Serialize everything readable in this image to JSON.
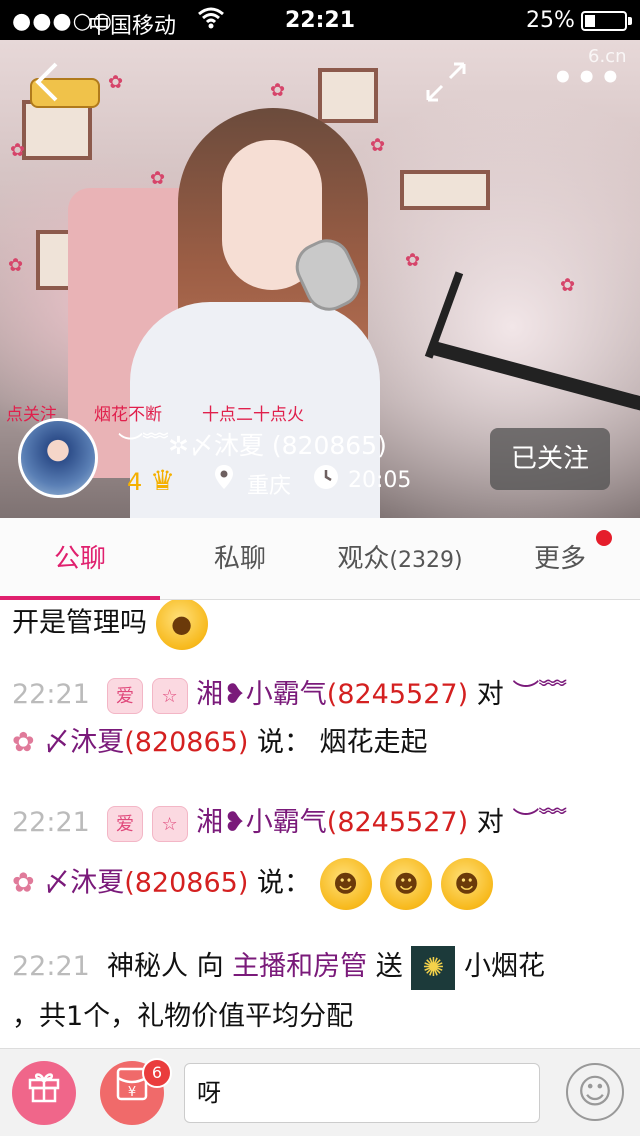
{
  "status_bar": {
    "signal": "●●●○○",
    "carrier": "中国移动",
    "wifi": "wifi",
    "time": "22:21",
    "battery": "25%"
  },
  "video": {
    "logo": "",
    "watermark": "6.cn",
    "tags": [
      "点关注",
      "烟花不断",
      "十点二十点火"
    ],
    "anchor_name": "︶﹌✲〆沐夏 (820865)",
    "level": "4",
    "location": "重庆",
    "duration": "20:05",
    "follow_label": "已关注"
  },
  "tabs": [
    {
      "label": "公聊",
      "count": "",
      "active": true
    },
    {
      "label": "私聊",
      "count": ""
    },
    {
      "label": "观众",
      "count": "(2329)"
    },
    {
      "label": "更多",
      "count": ""
    }
  ],
  "chat": {
    "msg0": {
      "text": "开是管理吗"
    },
    "msg1": {
      "time": "22:21",
      "badge1": "爱",
      "badge2": "☆",
      "sender": "湘❥小霸气",
      "sender_id": "(8245527)",
      "to": "对",
      "tail": "︶﹌",
      "target": "〆沐夏",
      "target_id": "(820865)",
      "said": "说：",
      "text": "烟花走起"
    },
    "msg2": {
      "time": "22:21",
      "badge1": "爱",
      "badge2": "☆",
      "sender": "湘❥小霸气",
      "sender_id": "(8245527)",
      "to": "对",
      "tail": "︶﹌",
      "target": "〆沐夏",
      "target_id": "(820865)",
      "said": "说："
    },
    "msg3": {
      "time": "22:21",
      "who": "神秘人",
      "to": "向",
      "recipients": "主播和房管",
      "verb": "送",
      "gift": "小烟花",
      "rest": "，共1个，礼物价值平均分配"
    }
  },
  "bottom": {
    "gift_icon": "gift-icon",
    "redbag_count": "6",
    "input_value": "呀",
    "emoji_icon": "smile-icon"
  }
}
